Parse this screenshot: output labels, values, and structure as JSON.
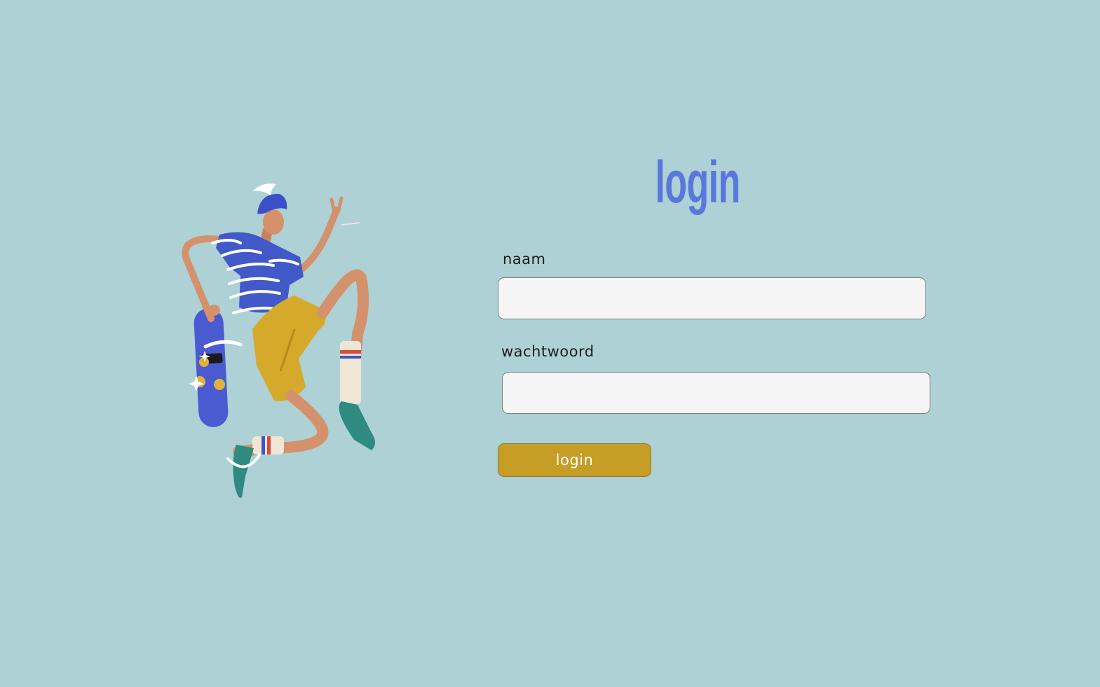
{
  "page": {
    "background_color": "#add1d5",
    "illustration_icon": "skateboarder-illustration"
  },
  "form": {
    "title": "login",
    "title_color": "#5a78dc",
    "name_label": "naam",
    "name_value": "",
    "password_label": "wachtwoord",
    "password_value": "",
    "submit_label": "login",
    "submit_color": "#c69e26"
  }
}
